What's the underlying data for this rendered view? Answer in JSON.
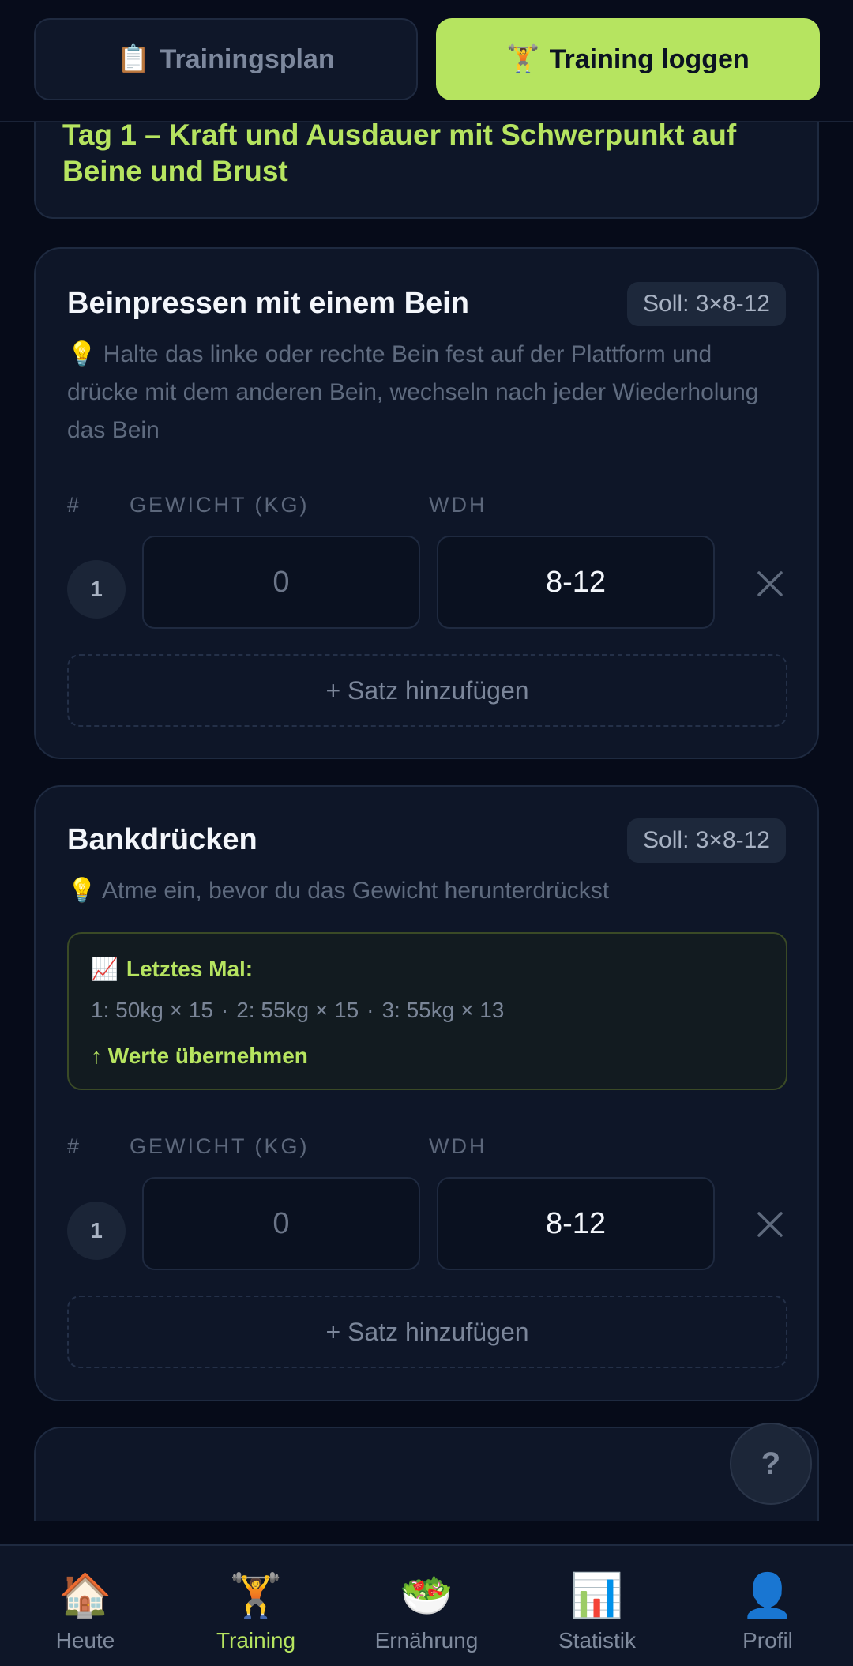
{
  "tabs": {
    "plan": {
      "icon": "📋",
      "label": "Trainingsplan"
    },
    "log": {
      "icon": "🏋️",
      "label": "Training loggen"
    }
  },
  "day": {
    "title": "Tag 1 – Kraft und Ausdauer mit Schwerpunkt auf Beine und Brust"
  },
  "columns": {
    "num": "#",
    "weight": "GEWICHT (KG)",
    "reps": "WDH"
  },
  "exercises": [
    {
      "name": "Beinpressen mit einem Bein",
      "target": "Soll: 3×8-12",
      "tip_icon": "💡",
      "tip": "Halte das linke oder rechte Bein fest auf der Plattform und drücke mit dem anderen Bein, wechseln nach jeder Wiederholung das Bein",
      "sets": [
        {
          "num": "1",
          "weight_placeholder": "0",
          "reps": "8-12"
        }
      ],
      "add_label": "+ Satz hinzufügen"
    },
    {
      "name": "Bankdrücken",
      "target": "Soll: 3×8-12",
      "tip_icon": "💡",
      "tip": "Atme ein, bevor du das Gewicht herunterdrückst",
      "last_time": {
        "icon": "📈",
        "title": "Letztes Mal:",
        "values": [
          "1: 50kg × 15",
          "2: 55kg × 15",
          "3: 55kg × 13"
        ],
        "separator": "·",
        "apply_label": "↑ Werte übernehmen"
      },
      "sets": [
        {
          "num": "1",
          "weight_placeholder": "0",
          "reps": "8-12"
        }
      ],
      "add_label": "+ Satz hinzufügen"
    }
  ],
  "help": {
    "label": "?"
  },
  "nav": [
    {
      "icon": "🏠",
      "label": "Heute",
      "active": false
    },
    {
      "icon": "🏋️",
      "label": "Training",
      "active": true
    },
    {
      "icon": "🥗",
      "label": "Ernährung",
      "active": false
    },
    {
      "icon": "📊",
      "label": "Statistik",
      "active": false
    },
    {
      "icon": "👤",
      "label": "Profil",
      "active": false
    }
  ],
  "colors": {
    "accent": "#b6e460",
    "background": "#060b19",
    "card": "#0e1628"
  }
}
